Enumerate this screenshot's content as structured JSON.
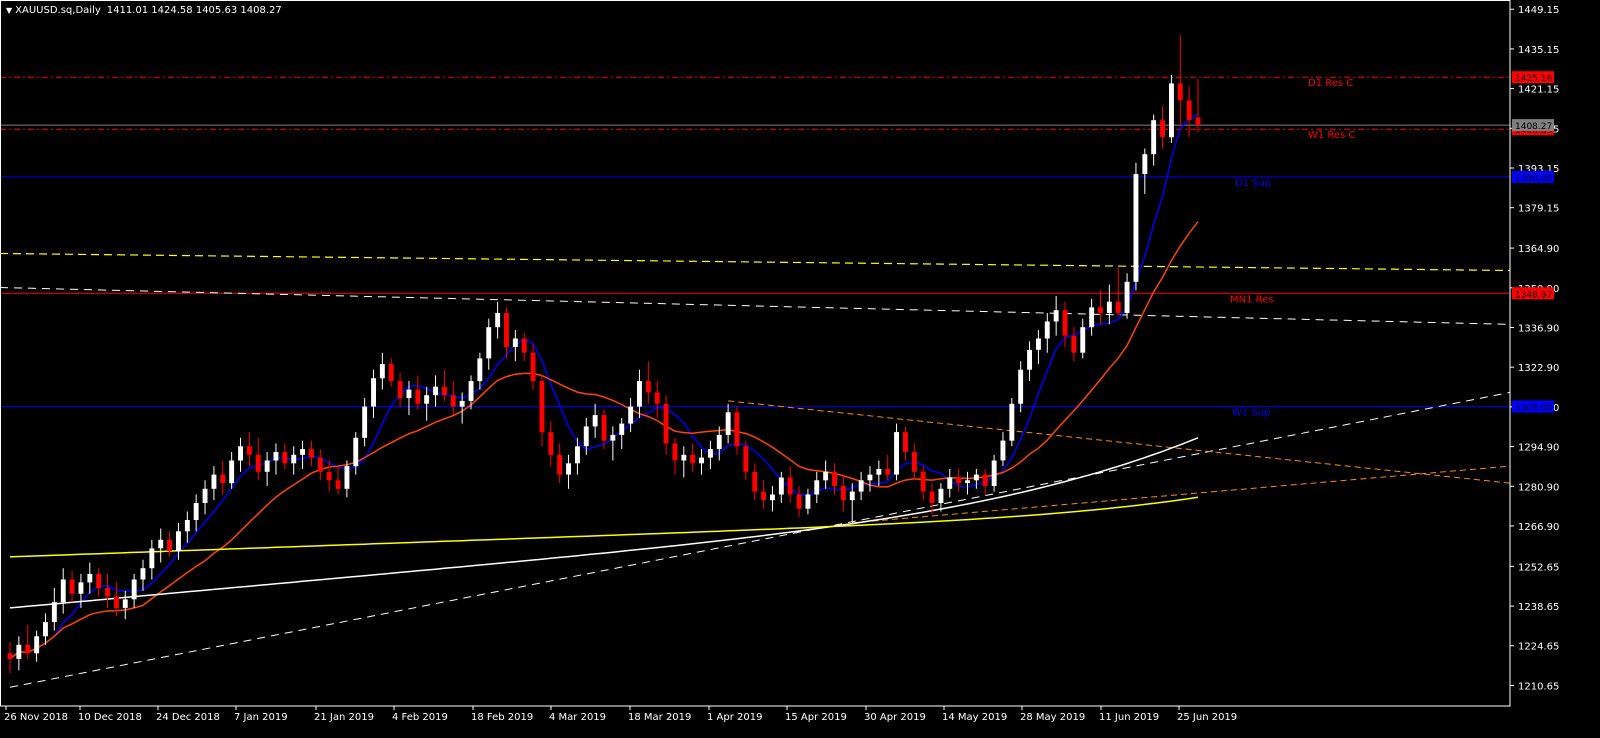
{
  "header": {
    "symbol": "XAUUSD.sq,Daily",
    "ohlc": "1411.01 1424.58 1405.63 1408.27",
    "menu_icon": "triangle-down-icon"
  },
  "colors": {
    "background": "#000000",
    "frame": "#ffffff",
    "bull_candle": "#ffffff",
    "bear_candle": "#ff0000",
    "resistance": "#ff0000",
    "support": "#0000ff",
    "ma_fast": "#0000ff",
    "ma_mid": "#ff4500",
    "ma_slow": "#ffffff",
    "ma_200": "#ffff00",
    "trendline_orange": "#ff8c00",
    "trendline_white": "#ffffff",
    "trendline_yellow": "#ffff00"
  },
  "chart_data": {
    "type": "candlestick",
    "timeframe": "Daily",
    "ylim": [
      1203.4,
      1452.4
    ],
    "y_ticks": [
      "1449.15",
      "1435.15",
      "1421.15",
      "1407.15",
      "1393.15",
      "1379.15",
      "1364.90",
      "1350.90",
      "1336.90",
      "1322.90",
      "1308.90",
      "1294.90",
      "1280.90",
      "1266.90",
      "1252.65",
      "1238.65",
      "1224.65",
      "1210.65"
    ],
    "x_ticks": [
      "26 Nov 2018",
      "10 Dec 2018",
      "24 Dec 2018",
      "7 Jan 2019",
      "21 Jan 2019",
      "4 Feb 2019",
      "18 Feb 2019",
      "4 Mar 2019",
      "18 Mar 2019",
      "1 Apr 2019",
      "15 Apr 2019",
      "30 Apr 2019",
      "14 May 2019",
      "28 May 2019",
      "11 Jun 2019",
      "25 Jun 2019"
    ],
    "levels": [
      {
        "label": "D1 Res C",
        "value": 1425.16,
        "price_label": "1425.16",
        "style": "dashdot",
        "color": "#ff0000"
      },
      {
        "label": "W1 Res C",
        "value": 1406.83,
        "price_label": "1406.83",
        "style": "dashdot",
        "color": "#ff0000"
      },
      {
        "label": "D1 Sup",
        "value": 1390.0,
        "price_label": "1390.00",
        "style": "solid",
        "color": "#0000ff"
      },
      {
        "label": "MN1 Res",
        "value": 1348.97,
        "price_label": "1348.97",
        "style": "solid",
        "color": "#ff0000"
      },
      {
        "label": "W1 Sup",
        "value": 1309.0,
        "price_label": "1309.00",
        "style": "solid",
        "color": "#0000ff"
      }
    ],
    "current_price": {
      "value": 1408.27,
      "price_label": "1408.27"
    },
    "candles": [
      [
        1222,
        1226,
        1215,
        1220
      ],
      [
        1220,
        1228,
        1216,
        1225
      ],
      [
        1225,
        1232,
        1220,
        1222
      ],
      [
        1222,
        1230,
        1219,
        1228
      ],
      [
        1228,
        1236,
        1225,
        1233
      ],
      [
        1233,
        1245,
        1230,
        1240
      ],
      [
        1240,
        1252,
        1236,
        1248
      ],
      [
        1248,
        1251,
        1240,
        1243
      ],
      [
        1243,
        1250,
        1238,
        1247
      ],
      [
        1247,
        1254,
        1243,
        1250
      ],
      [
        1250,
        1252,
        1242,
        1245
      ],
      [
        1245,
        1250,
        1238,
        1242
      ],
      [
        1242,
        1247,
        1235,
        1238
      ],
      [
        1238,
        1244,
        1234,
        1241
      ],
      [
        1241,
        1250,
        1238,
        1248
      ],
      [
        1248,
        1255,
        1244,
        1252
      ],
      [
        1252,
        1262,
        1248,
        1259
      ],
      [
        1259,
        1266,
        1254,
        1262
      ],
      [
        1262,
        1265,
        1256,
        1258
      ],
      [
        1258,
        1268,
        1255,
        1265
      ],
      [
        1265,
        1272,
        1261,
        1269
      ],
      [
        1269,
        1278,
        1265,
        1275
      ],
      [
        1275,
        1283,
        1271,
        1280
      ],
      [
        1280,
        1288,
        1276,
        1285
      ],
      [
        1285,
        1290,
        1278,
        1282
      ],
      [
        1282,
        1293,
        1280,
        1290
      ],
      [
        1290,
        1298,
        1286,
        1295
      ],
      [
        1295,
        1300,
        1288,
        1292
      ],
      [
        1292,
        1298,
        1283,
        1286
      ],
      [
        1286,
        1293,
        1281,
        1290
      ],
      [
        1290,
        1296,
        1285,
        1293
      ],
      [
        1293,
        1296,
        1287,
        1289
      ],
      [
        1289,
        1295,
        1285,
        1292
      ],
      [
        1292,
        1297,
        1287,
        1294
      ],
      [
        1294,
        1297,
        1288,
        1291
      ],
      [
        1291,
        1294,
        1283,
        1286
      ],
      [
        1286,
        1290,
        1279,
        1283
      ],
      [
        1283,
        1288,
        1278,
        1280
      ],
      [
        1280,
        1290,
        1277,
        1288
      ],
      [
        1288,
        1300,
        1285,
        1298
      ],
      [
        1298,
        1312,
        1295,
        1309
      ],
      [
        1309,
        1322,
        1305,
        1319
      ],
      [
        1319,
        1328,
        1315,
        1324
      ],
      [
        1324,
        1326,
        1316,
        1318
      ],
      [
        1318,
        1321,
        1309,
        1312
      ],
      [
        1312,
        1318,
        1306,
        1315
      ],
      [
        1315,
        1320,
        1308,
        1310
      ],
      [
        1310,
        1316,
        1304,
        1313
      ],
      [
        1313,
        1320,
        1309,
        1316
      ],
      [
        1316,
        1322,
        1311,
        1313
      ],
      [
        1313,
        1318,
        1306,
        1309
      ],
      [
        1309,
        1314,
        1303,
        1311
      ],
      [
        1311,
        1320,
        1308,
        1318
      ],
      [
        1318,
        1328,
        1315,
        1326
      ],
      [
        1326,
        1340,
        1322,
        1337
      ],
      [
        1337,
        1346,
        1333,
        1342
      ],
      [
        1342,
        1344,
        1326,
        1330
      ],
      [
        1330,
        1336,
        1325,
        1333
      ],
      [
        1333,
        1335,
        1325,
        1328
      ],
      [
        1328,
        1331,
        1315,
        1318
      ],
      [
        1318,
        1320,
        1295,
        1300
      ],
      [
        1300,
        1304,
        1288,
        1292
      ],
      [
        1292,
        1296,
        1282,
        1285
      ],
      [
        1285,
        1292,
        1280,
        1289
      ],
      [
        1289,
        1298,
        1285,
        1295
      ],
      [
        1295,
        1305,
        1292,
        1302
      ],
      [
        1302,
        1310,
        1298,
        1306
      ],
      [
        1306,
        1308,
        1294,
        1297
      ],
      [
        1297,
        1302,
        1290,
        1299
      ],
      [
        1299,
        1305,
        1294,
        1303
      ],
      [
        1303,
        1312,
        1300,
        1309
      ],
      [
        1309,
        1322,
        1305,
        1318
      ],
      [
        1318,
        1325,
        1310,
        1314
      ],
      [
        1314,
        1318,
        1305,
        1310
      ],
      [
        1310,
        1313,
        1292,
        1296
      ],
      [
        1296,
        1298,
        1285,
        1290
      ],
      [
        1290,
        1295,
        1284,
        1292
      ],
      [
        1292,
        1296,
        1286,
        1289
      ],
      [
        1289,
        1294,
        1285,
        1291
      ],
      [
        1291,
        1297,
        1287,
        1294
      ],
      [
        1294,
        1302,
        1290,
        1299
      ],
      [
        1299,
        1310,
        1296,
        1307
      ],
      [
        1307,
        1309,
        1292,
        1295
      ],
      [
        1295,
        1297,
        1283,
        1286
      ],
      [
        1286,
        1289,
        1276,
        1279
      ],
      [
        1279,
        1283,
        1273,
        1276
      ],
      [
        1276,
        1281,
        1272,
        1278
      ],
      [
        1278,
        1286,
        1275,
        1284
      ],
      [
        1284,
        1288,
        1275,
        1278
      ],
      [
        1278,
        1281,
        1270,
        1273
      ],
      [
        1273,
        1280,
        1271,
        1278
      ],
      [
        1278,
        1286,
        1275,
        1283
      ],
      [
        1283,
        1290,
        1280,
        1286
      ],
      [
        1286,
        1289,
        1278,
        1281
      ],
      [
        1281,
        1285,
        1272,
        1276
      ],
      [
        1276,
        1282,
        1268,
        1279
      ],
      [
        1279,
        1286,
        1276,
        1283
      ],
      [
        1283,
        1288,
        1279,
        1285
      ],
      [
        1285,
        1290,
        1281,
        1287
      ],
      [
        1287,
        1292,
        1283,
        1285
      ],
      [
        1285,
        1303,
        1283,
        1300
      ],
      [
        1300,
        1302,
        1290,
        1293
      ],
      [
        1293,
        1296,
        1283,
        1286
      ],
      [
        1286,
        1288,
        1276,
        1279
      ],
      [
        1279,
        1282,
        1271,
        1275
      ],
      [
        1275,
        1282,
        1272,
        1280
      ],
      [
        1280,
        1287,
        1277,
        1284
      ],
      [
        1284,
        1287,
        1279,
        1282
      ],
      [
        1282,
        1286,
        1278,
        1283
      ],
      [
        1283,
        1287,
        1280,
        1285
      ],
      [
        1285,
        1287,
        1278,
        1281
      ],
      [
        1281,
        1292,
        1279,
        1290
      ],
      [
        1290,
        1300,
        1288,
        1297
      ],
      [
        1297,
        1312,
        1295,
        1310
      ],
      [
        1310,
        1325,
        1307,
        1322
      ],
      [
        1322,
        1332,
        1318,
        1329
      ],
      [
        1329,
        1336,
        1324,
        1333
      ],
      [
        1333,
        1342,
        1328,
        1339
      ],
      [
        1339,
        1348,
        1334,
        1343
      ],
      [
        1343,
        1346,
        1330,
        1334
      ],
      [
        1334,
        1337,
        1325,
        1328
      ],
      [
        1328,
        1340,
        1326,
        1337
      ],
      [
        1337,
        1347,
        1334,
        1344
      ],
      [
        1344,
        1350,
        1338,
        1342
      ],
      [
        1342,
        1352,
        1338,
        1346
      ],
      [
        1346,
        1358,
        1341,
        1342
      ],
      [
        1342,
        1356,
        1340,
        1353
      ],
      [
        1353,
        1395,
        1350,
        1391
      ],
      [
        1391,
        1400,
        1384,
        1398
      ],
      [
        1398,
        1412,
        1394,
        1410
      ],
      [
        1410,
        1415,
        1400,
        1404
      ],
      [
        1404,
        1426,
        1402,
        1423
      ],
      [
        1423,
        1440,
        1408,
        1417
      ],
      [
        1417,
        1422,
        1404,
        1410
      ],
      [
        1411.01,
        1424.58,
        1405.63,
        1408.27
      ]
    ]
  }
}
